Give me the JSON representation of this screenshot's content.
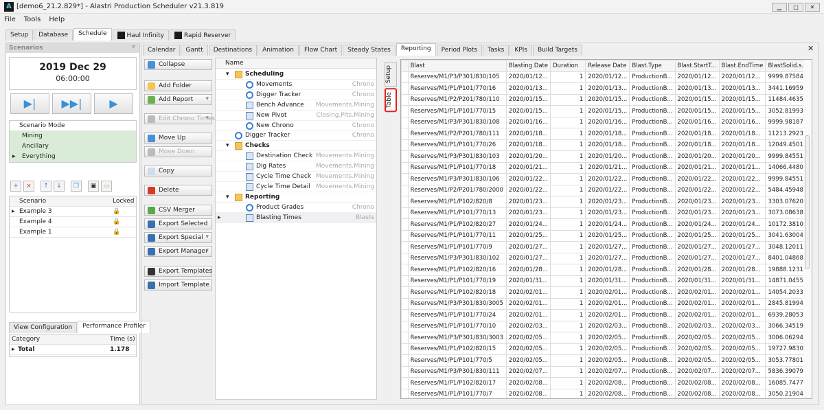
{
  "window": {
    "title": "[demo6_21.2.829*] - Alastri Production Scheduler v21.3.819",
    "logo": "A"
  },
  "menu": [
    "File",
    "Tools",
    "Help"
  ],
  "top_tabs": [
    "Setup",
    "Database",
    "Schedule",
    "Haul Infinity",
    "Rapid Reserver"
  ],
  "left": {
    "header": "Scenarios",
    "pin": "ᵖ",
    "date": "2019 Dec 29",
    "time": "06:00:00",
    "mode_header": "Scenario Mode",
    "modes": [
      "Mining",
      "Ancillary",
      "Everything"
    ],
    "scen_headers": [
      "Scenario",
      "Locked"
    ],
    "scenarios": [
      "Example 3",
      "Example 4",
      "Example 1"
    ],
    "bottom_tabs": [
      "View Configuration",
      "Performance Profiler"
    ],
    "prof_headers": [
      "Category",
      "Time (s)"
    ],
    "prof_rows": [
      {
        "cat": "Total",
        "time": "1.178"
      }
    ]
  },
  "inner_tabs": [
    "Calendar",
    "Gantt",
    "Destinations",
    "Animation",
    "Flow Chart",
    "Steady States",
    "Reporting",
    "Period Plots",
    "Tasks",
    "KPIs",
    "Build Targets"
  ],
  "buttons": [
    {
      "label": "Collapse",
      "icon": "collapse-icon",
      "color": "#4a90d9"
    },
    {
      "label": "Add Folder",
      "icon": "folder-icon",
      "color": "#f5c45a"
    },
    {
      "label": "Add Report",
      "icon": "add-report-icon",
      "color": "#6ab04c",
      "dd": "▾"
    },
    {
      "label": "Edit Chrono Times",
      "icon": "edit-chrono-icon",
      "color": "#bbb",
      "dd": "▾",
      "disabled": true
    },
    {
      "label": "Move Up",
      "icon": "arrow-up-icon",
      "color": "#4a90d9"
    },
    {
      "label": "Move Down",
      "icon": "arrow-down-icon",
      "color": "#bbb",
      "disabled": true
    },
    {
      "label": "Copy",
      "icon": "copy-icon",
      "color": "#cfdcec"
    },
    {
      "label": "Delete",
      "icon": "delete-icon",
      "color": "#d83a2a"
    },
    {
      "label": "CSV Merger",
      "icon": "csv-merger-icon",
      "color": "#5aa84a"
    },
    {
      "label": "Export Selected",
      "icon": "export-selected-icon",
      "color": "#3a6fb0"
    },
    {
      "label": "Export Special",
      "icon": "export-special-icon",
      "color": "#3a6fb0",
      "dd": "▾"
    },
    {
      "label": "Export Manager",
      "icon": "export-manager-icon",
      "color": "#3a6fb0",
      "dd": "▾"
    },
    {
      "label": "Export Templates",
      "icon": "save-icon",
      "color": "#333"
    },
    {
      "label": "Import Template",
      "icon": "import-icon",
      "color": "#3a6fb0"
    }
  ],
  "tree": {
    "header": "Name",
    "items": [
      {
        "name": "Scheduling",
        "level": 0,
        "kind": "folder",
        "type": ""
      },
      {
        "name": "Movements",
        "level": 1,
        "kind": "clock",
        "type": "Chrono"
      },
      {
        "name": "Digger Tracker",
        "level": 1,
        "kind": "clock",
        "type": "Chrono"
      },
      {
        "name": "Bench Advance",
        "level": 1,
        "kind": "rep",
        "type": "Movements.Mining"
      },
      {
        "name": "New Pivot",
        "level": 1,
        "kind": "rep",
        "type": "Closing.Pits.Mining"
      },
      {
        "name": "New Chrono",
        "level": 1,
        "kind": "clock",
        "type": "Chrono"
      },
      {
        "name": "Digger Tracker",
        "level": 0,
        "kind": "clock",
        "type": "Chrono"
      },
      {
        "name": "Checks",
        "level": 0,
        "kind": "folder",
        "type": ""
      },
      {
        "name": "Destination Check",
        "level": 1,
        "kind": "rep",
        "type": "Movements.Mining"
      },
      {
        "name": "Dig Rates",
        "level": 1,
        "kind": "rep",
        "type": "Movements.Mining"
      },
      {
        "name": "Cycle Time Check",
        "level": 1,
        "kind": "rep",
        "type": "Movements.Mining"
      },
      {
        "name": "Cycle Time Detail",
        "level": 1,
        "kind": "rep",
        "type": "Movements.Mining"
      },
      {
        "name": "Reporting",
        "level": 0,
        "kind": "folder",
        "type": ""
      },
      {
        "name": "Product Grades",
        "level": 1,
        "kind": "clock",
        "type": "Chrono"
      },
      {
        "name": "Blasting Times",
        "level": 1,
        "kind": "rep",
        "type": "Blasts"
      }
    ]
  },
  "side_tabs": [
    "Setup",
    "Table"
  ],
  "table": {
    "columns": [
      "Blast",
      "Blasting Date",
      "Duration",
      "Release Date",
      "Blast.Type",
      "Blast.StartT...",
      "Blast.EndTime",
      "BlastSolid.s..."
    ],
    "rows": [
      [
        "Reserves/M1/P3/P301/830/105",
        "2020/01/12...",
        "1",
        "2020/01/12...",
        "ProductionB...",
        "2020/01/12...",
        "2020/01/12...",
        "9999.87584..."
      ],
      [
        "Reserves/M1/P1/P101/770/16",
        "2020/01/13...",
        "1",
        "2020/01/13...",
        "ProductionB...",
        "2020/01/13...",
        "2020/01/13...",
        "3441.16959..."
      ],
      [
        "Reserves/M1/P2/P201/780/110",
        "2020/01/15...",
        "1",
        "2020/01/15...",
        "ProductionB...",
        "2020/01/15...",
        "2020/01/15...",
        "11484.4635..."
      ],
      [
        "Reserves/M1/P1/P101/770/15",
        "2020/01/15...",
        "1",
        "2020/01/15...",
        "ProductionB...",
        "2020/01/15...",
        "2020/01/15...",
        "3052.81993..."
      ],
      [
        "Reserves/M1/P3/P301/830/108",
        "2020/01/16...",
        "1",
        "2020/01/16...",
        "ProductionB...",
        "2020/01/16...",
        "2020/01/16...",
        "9999.98187..."
      ],
      [
        "Reserves/M1/P2/P201/780/111",
        "2020/01/18...",
        "1",
        "2020/01/18...",
        "ProductionB...",
        "2020/01/18...",
        "2020/01/18...",
        "11213.2923..."
      ],
      [
        "Reserves/M1/P1/P101/770/26",
        "2020/01/18...",
        "1",
        "2020/01/18...",
        "ProductionB...",
        "2020/01/18...",
        "2020/01/18...",
        "12049.4501..."
      ],
      [
        "Reserves/M1/P3/P301/830/103",
        "2020/01/20...",
        "1",
        "2020/01/20...",
        "ProductionB...",
        "2020/01/20...",
        "2020/01/20...",
        "9999.84551..."
      ],
      [
        "Reserves/M1/P1/P101/770/18",
        "2020/01/21...",
        "1",
        "2020/01/21...",
        "ProductionB...",
        "2020/01/21...",
        "2020/01/21...",
        "14066.4480..."
      ],
      [
        "Reserves/M1/P3/P301/830/106",
        "2020/01/22...",
        "1",
        "2020/01/22...",
        "ProductionB...",
        "2020/01/22...",
        "2020/01/22...",
        "9999.84551..."
      ],
      [
        "Reserves/M1/P2/P201/780/2000",
        "2020/01/22...",
        "1",
        "2020/01/22...",
        "ProductionB...",
        "2020/01/22...",
        "2020/01/22...",
        "5484.45948..."
      ],
      [
        "Reserves/M1/P1/P102/820/8",
        "2020/01/23...",
        "1",
        "2020/01/23...",
        "ProductionB...",
        "2020/01/23...",
        "2020/01/23...",
        "3303.07620..."
      ],
      [
        "Reserves/M1/P1/P101/770/13",
        "2020/01/23...",
        "1",
        "2020/01/23...",
        "ProductionB...",
        "2020/01/23...",
        "2020/01/23...",
        "3073.08638..."
      ],
      [
        "Reserves/M1/P1/P102/820/27",
        "2020/01/24...",
        "1",
        "2020/01/24...",
        "ProductionB...",
        "2020/01/24...",
        "2020/01/24...",
        "10172.3810..."
      ],
      [
        "Reserves/M1/P1/P101/770/11",
        "2020/01/25...",
        "1",
        "2020/01/25...",
        "ProductionB...",
        "2020/01/25...",
        "2020/01/25...",
        "3041.63004..."
      ],
      [
        "Reserves/M1/P1/P101/770/9",
        "2020/01/27...",
        "1",
        "2020/01/27...",
        "ProductionB...",
        "2020/01/27...",
        "2020/01/27...",
        "3048.12011..."
      ],
      [
        "Reserves/M1/P3/P301/830/102",
        "2020/01/27...",
        "1",
        "2020/01/27...",
        "ProductionB...",
        "2020/01/27...",
        "2020/01/27...",
        "8401.04868..."
      ],
      [
        "Reserves/M1/P1/P102/820/16",
        "2020/01/28...",
        "1",
        "2020/01/28...",
        "ProductionB...",
        "2020/01/28...",
        "2020/01/28...",
        "19888.1231..."
      ],
      [
        "Reserves/M1/P1/P101/770/19",
        "2020/01/31...",
        "1",
        "2020/01/31...",
        "ProductionB...",
        "2020/01/31...",
        "2020/01/31...",
        "14871.0455..."
      ],
      [
        "Reserves/M1/P1/P102/820/18",
        "2020/02/01...",
        "1",
        "2020/02/01...",
        "ProductionB...",
        "2020/02/01...",
        "2020/02/01...",
        "14054.2033..."
      ],
      [
        "Reserves/M1/P3/P301/830/3005",
        "2020/02/01...",
        "1",
        "2020/02/01...",
        "ProductionB...",
        "2020/02/01...",
        "2020/02/01...",
        "2845.81994..."
      ],
      [
        "Reserves/M1/P1/P101/770/24",
        "2020/02/01...",
        "1",
        "2020/02/01...",
        "ProductionB...",
        "2020/02/01...",
        "2020/02/01...",
        "6939.28053..."
      ],
      [
        "Reserves/M1/P1/P101/770/10",
        "2020/02/03...",
        "1",
        "2020/02/03...",
        "ProductionB...",
        "2020/02/03...",
        "2020/02/03...",
        "3066.34519..."
      ],
      [
        "Reserves/M1/P3/P301/830/3003",
        "2020/02/05...",
        "1",
        "2020/02/05...",
        "ProductionB...",
        "2020/02/05...",
        "2020/02/05...",
        "3006.06294..."
      ],
      [
        "Reserves/M1/P1/P102/820/15",
        "2020/02/05...",
        "1",
        "2020/02/05...",
        "ProductionB...",
        "2020/02/05...",
        "2020/02/05...",
        "19727.9830..."
      ],
      [
        "Reserves/M1/P1/P101/770/5",
        "2020/02/05...",
        "1",
        "2020/02/05...",
        "ProductionB...",
        "2020/02/05...",
        "2020/02/05...",
        "3053.77801..."
      ],
      [
        "Reserves/M1/P3/P301/830/111",
        "2020/02/07...",
        "1",
        "2020/02/07...",
        "ProductionB...",
        "2020/02/07...",
        "2020/02/07...",
        "5836.39079..."
      ],
      [
        "Reserves/M1/P1/P102/820/17",
        "2020/02/08...",
        "1",
        "2020/02/08...",
        "ProductionB...",
        "2020/02/08...",
        "2020/02/08...",
        "16085.7477..."
      ],
      [
        "Reserves/M1/P1/P101/770/7",
        "2020/02/08...",
        "1",
        "2020/02/08...",
        "ProductionB...",
        "2020/02/08...",
        "2020/02/08...",
        "3050.21904..."
      ]
    ]
  }
}
